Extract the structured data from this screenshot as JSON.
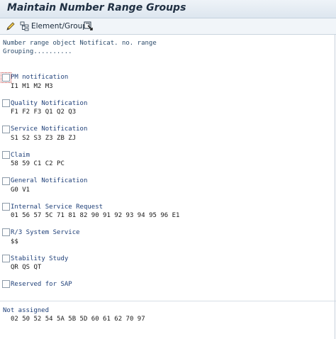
{
  "window": {
    "title": "Maintain Number Range Groups"
  },
  "toolbar": {
    "element_group_label": "Element/Group"
  },
  "header": {
    "line1": "Number range object Notificat. no. range",
    "line2": "Grouping.........."
  },
  "groups": [
    {
      "name": "PM notification",
      "codes": "I1 M1 M2 M3"
    },
    {
      "name": "Quality Notification",
      "codes": "F1 F2 F3 Q1 Q2 Q3"
    },
    {
      "name": "Service Notification",
      "codes": "S1 S2 S3 Z3 ZB ZJ"
    },
    {
      "name": "Claim",
      "codes": "58 59 C1 C2 PC"
    },
    {
      "name": "General Notification",
      "codes": "G0 V1"
    },
    {
      "name": "Internal Service Request",
      "codes": "01 56 57 5C 71 81 82 90 91 92 93 94 95 96 E1"
    },
    {
      "name": "R/3 System Service",
      "codes": "$$"
    },
    {
      "name": "Stability Study",
      "codes": "QR QS QT"
    },
    {
      "name": "Reserved for SAP",
      "codes": ""
    }
  ],
  "not_assigned": {
    "label": "Not assigned",
    "codes": "02 50 52 54 5A 5B 5D 60 61 62 70 97"
  },
  "colors": {
    "title_text": "#1f2f42",
    "group_name": "#1e3f78",
    "focus_outline": "#c03030"
  },
  "icons": [
    "pencil-icon",
    "hierarchy-icon",
    "select-icon"
  ]
}
